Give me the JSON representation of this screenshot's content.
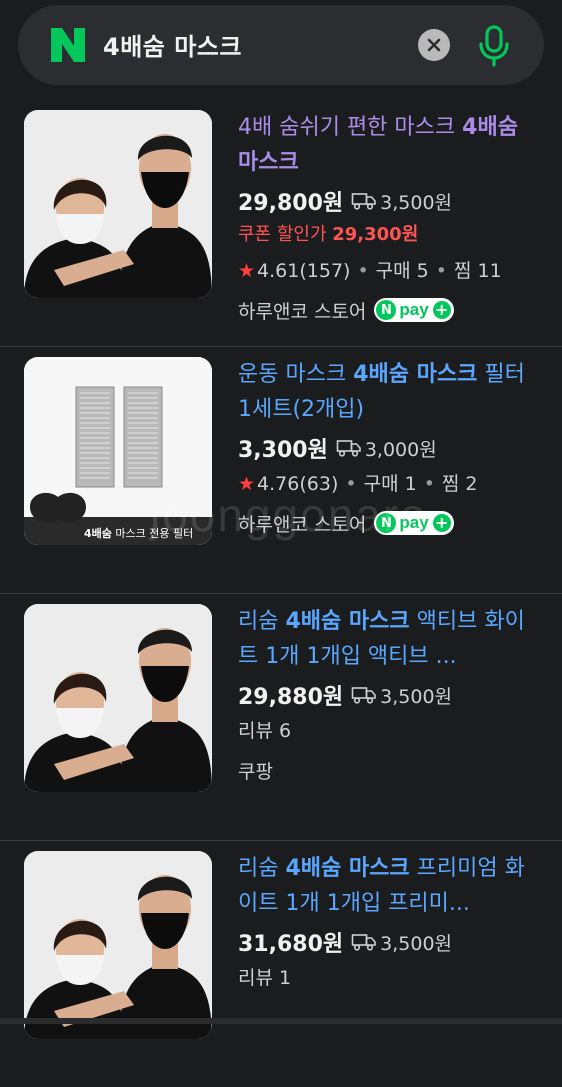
{
  "search": {
    "query": "4배숨 마스크"
  },
  "watermark": "joonggonara",
  "products": [
    {
      "title_parts": [
        {
          "text": "4배 숨쉬기 편한 마스크 ",
          "bold": false
        },
        {
          "text": "4배숨 마스크",
          "bold": true
        }
      ],
      "visited": true,
      "price": "29,800원",
      "shipping": "3,500원",
      "coupon_label": "쿠폰 할인가 ",
      "coupon_price": "29,300원",
      "rating": "4.61",
      "reviews": "(157)",
      "purchases": "구매 5",
      "wishes": "찜 11",
      "review_count": "",
      "store": "하루앤코 스토어",
      "npay": true,
      "image": "person-mask-black"
    },
    {
      "title_parts": [
        {
          "text": "운동 마스크 ",
          "bold": false
        },
        {
          "text": "4배숨 마스크",
          "bold": true
        },
        {
          "text": " 필터 1세트(2개입)",
          "bold": false
        }
      ],
      "visited": false,
      "price": "3,300원",
      "shipping": "3,000원",
      "coupon_label": "",
      "coupon_price": "",
      "rating": "4.76",
      "reviews": "(63)",
      "purchases": "구매 1",
      "wishes": "찜 2",
      "review_count": "",
      "store": "하루앤코 스토어",
      "npay": true,
      "image": "filter",
      "image_caption_bold": "4배숨",
      "image_caption": " 마스크 전용 필터"
    },
    {
      "title_parts": [
        {
          "text": "리숨 ",
          "bold": false
        },
        {
          "text": "4배숨 마스크",
          "bold": true
        },
        {
          "text": " 액티브 화이트 1개 1개입 액티브 ...",
          "bold": false
        }
      ],
      "visited": false,
      "price": "29,880원",
      "shipping": "3,500원",
      "coupon_label": "",
      "coupon_price": "",
      "rating": "",
      "reviews": "",
      "purchases": "",
      "wishes": "",
      "review_count": "리뷰 6",
      "store": "쿠팡",
      "npay": false,
      "image": "person-mask-black"
    },
    {
      "title_parts": [
        {
          "text": "리숨 ",
          "bold": false
        },
        {
          "text": "4배숨 마스크",
          "bold": true
        },
        {
          "text": " 프리미엄 화이트 1개 1개입 프리미...",
          "bold": false
        }
      ],
      "visited": false,
      "price": "31,680원",
      "shipping": "3,500원",
      "coupon_label": "",
      "coupon_price": "",
      "rating": "",
      "reviews": "",
      "purchases": "",
      "wishes": "",
      "review_count": "리뷰 1",
      "store": "",
      "npay": false,
      "image": "person-mask-black"
    }
  ],
  "npay_label": {
    "n": "N",
    "pay": "pay",
    "plus": "+"
  },
  "colors": {
    "link": "#5aa7ff",
    "visited": "#a98ce8",
    "coupon": "#ff5454",
    "naver_green": "#03c75a"
  }
}
